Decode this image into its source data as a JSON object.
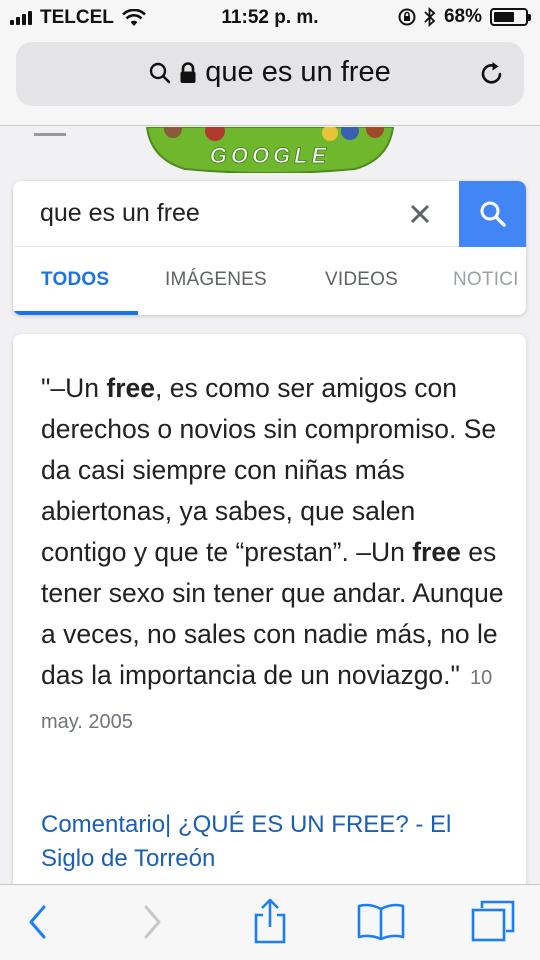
{
  "status_bar": {
    "carrier": "TELCEL",
    "time": "11:52 p. m.",
    "battery_percent": "68%",
    "battery_level": 0.68,
    "icons": [
      "signal-icon",
      "wifi-icon",
      "rotation-lock-icon",
      "bluetooth-icon",
      "battery-icon"
    ]
  },
  "browser": {
    "url_text": "que es un free",
    "icons": [
      "search-icon",
      "lock-icon",
      "reload-icon"
    ]
  },
  "google": {
    "doodle_text": "GOOGLE",
    "search_query": "que es un free",
    "tabs": [
      "TODOS",
      "IMÁGENES",
      "VIDEOS",
      "NOTICI"
    ],
    "active_tab": "TODOS",
    "accent_color": "#4285f4"
  },
  "result": {
    "snippet_parts": [
      {
        "text": "\"–Un ",
        "bold": false
      },
      {
        "text": "free",
        "bold": true
      },
      {
        "text": ", es como ser amigos con derechos o novios sin compromiso. Se da casi siempre con niñas más abiertonas, ya sabes, que salen contigo y que te “prestan”. –Un ",
        "bold": false
      },
      {
        "text": "free",
        "bold": true
      },
      {
        "text": " es tener sexo sin tener que andar. Aunque a veces, no sales con nadie más, no le das la importancia de un noviazgo.\"",
        "bold": false
      }
    ],
    "date": "10 may. 2005",
    "link_title": "Comentario| ¿QUÉ ES UN FREE? - El Siglo de Torreón"
  },
  "toolbar": {
    "icons": [
      "back-icon",
      "forward-icon",
      "share-icon",
      "bookmarks-icon",
      "tabs-icon"
    ]
  }
}
